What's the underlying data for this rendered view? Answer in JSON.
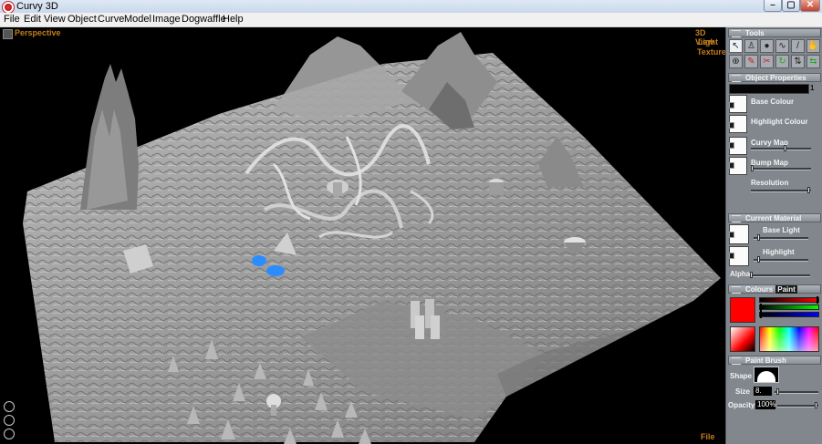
{
  "window": {
    "title": "Curvy 3D",
    "minimize": "–",
    "maximize": "▢",
    "close": "✕"
  },
  "menu": [
    "File",
    "Edit",
    "View",
    "Object",
    "Curve",
    "Model",
    "Image",
    "Dogwaffle",
    "Help"
  ],
  "viewport": {
    "mode_label": "Perspective",
    "options": [
      "3D View",
      "Light",
      "Texture"
    ],
    "footer_label": "File"
  },
  "tools": {
    "title": "Tools",
    "icons": [
      "select-arrow-icon",
      "figure-icon",
      "paint-bucket-icon",
      "curve-tool-icon",
      "brush-icon",
      "pan-hand-icon",
      "crosshair-icon",
      "pen-icon",
      "cut-icon",
      "rotate-icon",
      "scale-icon",
      "move-icon"
    ]
  },
  "object_properties": {
    "title": "Object Properties",
    "value": "1",
    "base_colour": "Base Colour",
    "highlight_colour": "Highlight Colour",
    "curvy_map": "Curvy Map",
    "bump_map": "Bump Map",
    "resolution": "Resolution"
  },
  "current_material": {
    "title": "Current Material",
    "base_light": "Base Light",
    "highlight": "Highlight",
    "alpha": "Alpha"
  },
  "colours": {
    "title": "Colours",
    "tab_paint": "Paint",
    "current_color": "#ff0000",
    "red_level": 1.0,
    "green_level": 0.0,
    "blue_level": 0.0
  },
  "paint_brush": {
    "title": "Paint Brush",
    "shape_label": "Shape",
    "size_label": "Size",
    "size_value": "8.",
    "opacity_label": "Opacity",
    "opacity_value": "100%"
  }
}
